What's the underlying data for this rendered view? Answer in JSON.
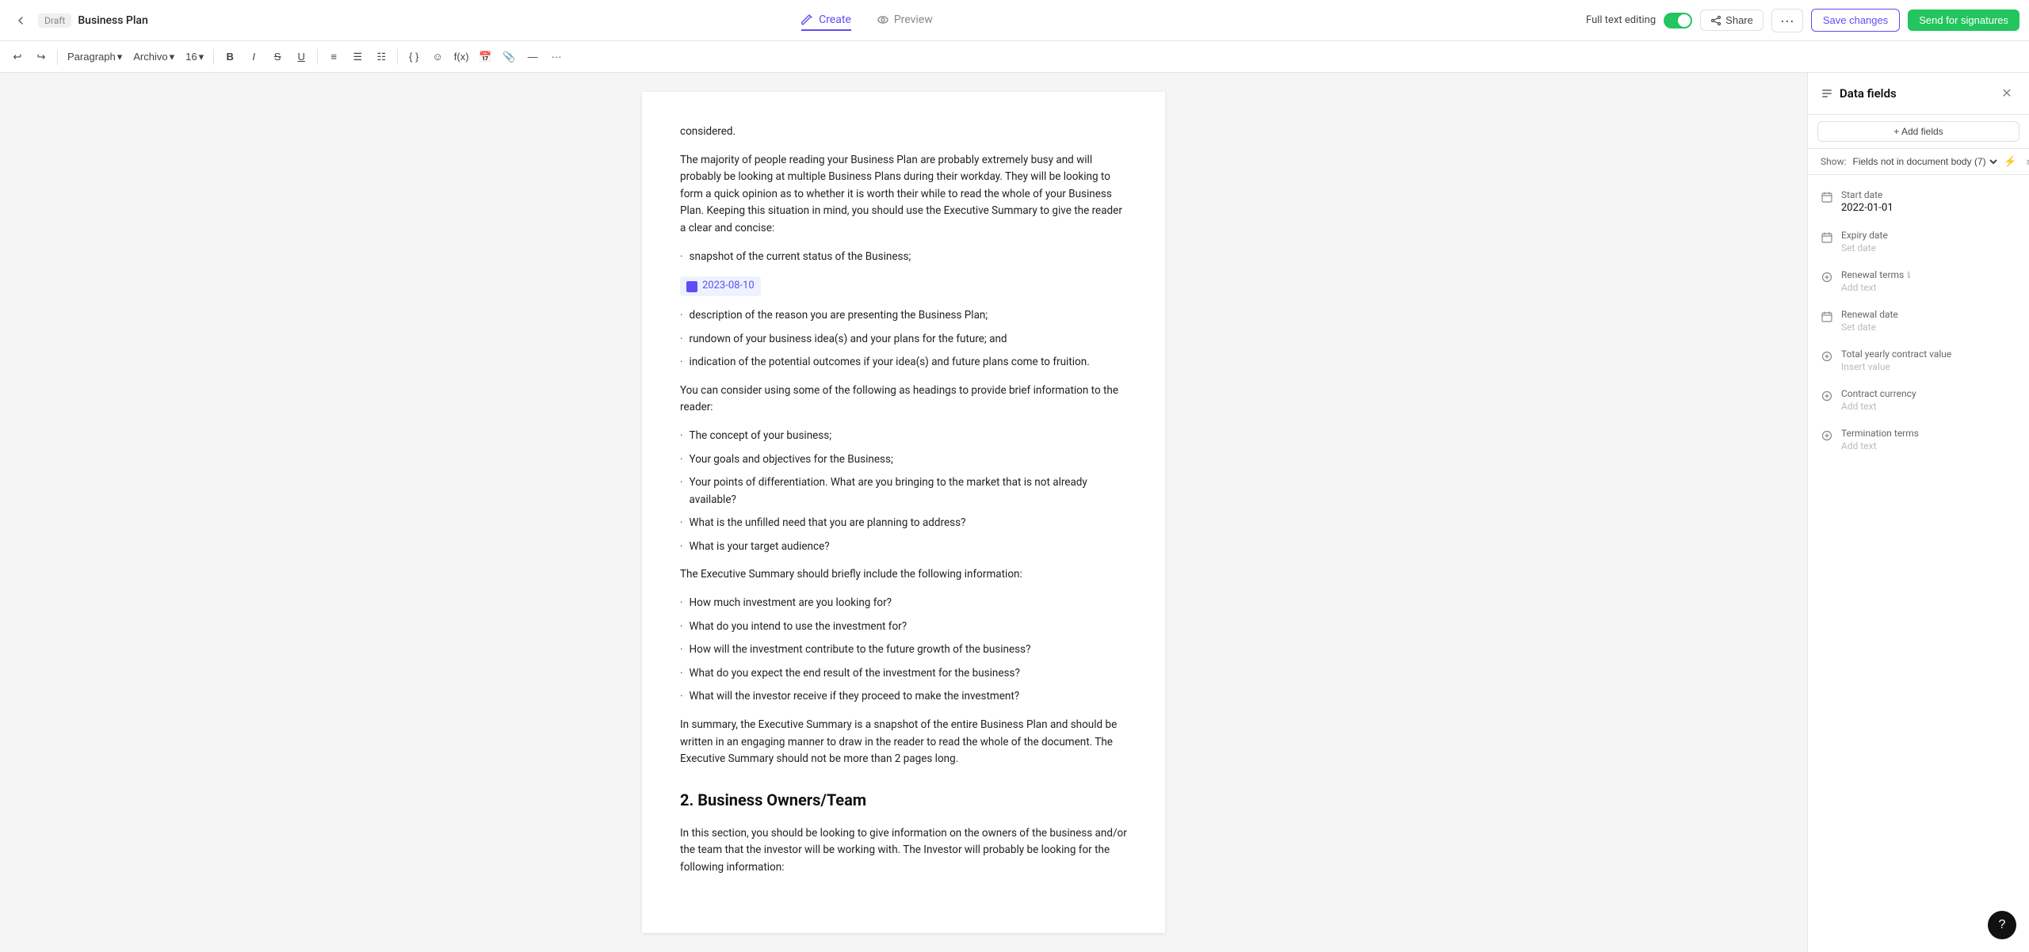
{
  "nav": {
    "back_label": "←",
    "draft_label": "Draft",
    "doc_title": "Business Plan",
    "create_tab": "Create",
    "preview_tab": "Preview",
    "full_text_label": "Full text editing",
    "share_label": "Share",
    "more_label": "···",
    "save_label": "Save changes",
    "send_label": "Send for signatures"
  },
  "toolbar": {
    "undo": "↩",
    "redo": "↪",
    "paragraph_label": "Paragraph",
    "font_label": "Archivo",
    "size_label": "16",
    "bold": "B",
    "italic": "I",
    "strikethrough": "S",
    "underline": "U",
    "align": "≡",
    "list": "☰",
    "ordered_list": "☷",
    "variable": "{ }",
    "emoji": "☺",
    "formula": "f(x)",
    "calendar": "📅",
    "attachment": "📎",
    "dash": "—",
    "more": "···"
  },
  "content": {
    "intro_para": "considered.",
    "para1": "The majority of people reading your Business Plan are probably extremely busy and will probably be looking at multiple Business Plans during their workday. They will be looking to form a quick opinion as to whether it is worth their while to read the whole of your Business Plan. Keeping this situation in mind, you should use the Executive Summary to give the reader a clear and concise:",
    "bullet1": "snapshot of the current status of the Business;",
    "date_tag": "2023-08-10",
    "bullet2": "description of the reason you are presenting the Business Plan;",
    "bullet3": "rundown of your business idea(s) and your plans for the future; and",
    "bullet4": "indication of the potential outcomes if your idea(s) and future plans come to fruition.",
    "para2": "You can consider using some of the following as headings to provide brief information to the reader:",
    "bullet5": "The concept of your business;",
    "bullet6": "Your goals and objectives for the Business;",
    "bullet7": "Your points of differentiation. What are you bringing to the market that is not already available?",
    "bullet8": "What is the unfilled need that you are planning to address?",
    "bullet9": "What is your target audience?",
    "para3": "The Executive Summary should briefly include the following information:",
    "bullet10": "How much investment are you looking for?",
    "bullet11": "What do you intend to use the investment for?",
    "bullet12": "How will the investment contribute to the future growth of the business?",
    "bullet13": "What do you expect the end result of the investment for the business?",
    "bullet14": "What will the investor receive if they proceed to make the investment?",
    "para4": "In summary, the Executive Summary is a snapshot of the entire Business Plan and should be written in an engaging manner to draw in the reader to read the whole of the document. The Executive Summary should not be more than 2 pages long.",
    "section2_heading": "2. Business Owners/Team",
    "section2_para": "In this section, you should be looking to give information on the owners of the business and/or the team that the investor will be working with. The Investor will probably be looking for the following information:"
  },
  "panel": {
    "title": "Data fields",
    "add_fields_label": "+ Add fields",
    "show_label": "Show:",
    "filter_value": "Fields not in document body (7)",
    "fields": [
      {
        "name": "Start date",
        "value": "2022-01-01",
        "type": "date",
        "placeholder": ""
      },
      {
        "name": "Expiry date",
        "value": "",
        "type": "date",
        "placeholder": "Set date"
      },
      {
        "name": "Renewal terms",
        "value": "",
        "type": "text",
        "placeholder": "Add text",
        "has_info": true
      },
      {
        "name": "Renewal date",
        "value": "",
        "type": "date",
        "placeholder": "Set date"
      },
      {
        "name": "Total yearly contract value",
        "value": "",
        "type": "number",
        "placeholder": "Insert value"
      },
      {
        "name": "Contract currency",
        "value": "",
        "type": "text",
        "placeholder": "Add text"
      },
      {
        "name": "Termination terms",
        "value": "",
        "type": "text",
        "placeholder": "Add text"
      }
    ]
  }
}
